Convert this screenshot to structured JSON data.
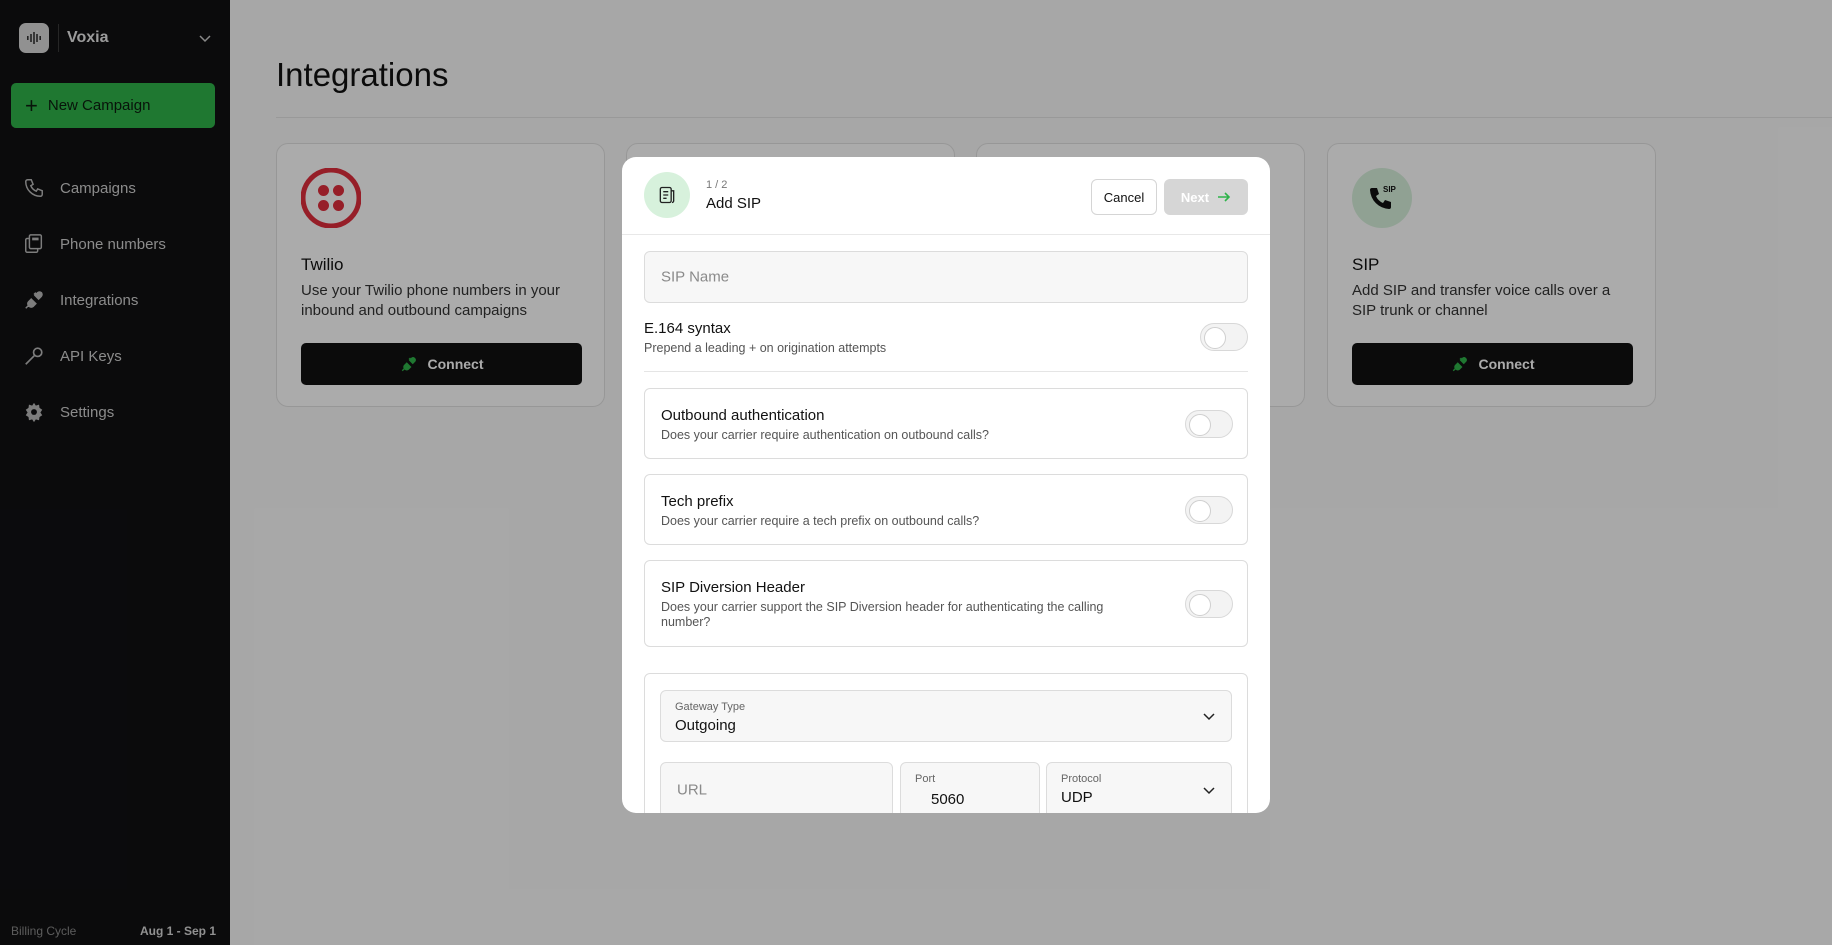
{
  "app": {
    "workspace_name": "Voxia",
    "new_campaign_label": "New Campaign",
    "accent_color": "#2fb34a"
  },
  "sidebar": {
    "items": [
      {
        "label": "Campaigns",
        "icon": "phone-icon"
      },
      {
        "label": "Phone numbers",
        "icon": "phone-numbers-icon"
      },
      {
        "label": "Integrations",
        "icon": "plug-icon"
      },
      {
        "label": "API Keys",
        "icon": "key-icon"
      },
      {
        "label": "Settings",
        "icon": "gear-icon"
      }
    ],
    "billing_label": "Billing Cycle",
    "billing_value": "Aug 1 - Sep 1"
  },
  "main": {
    "title": "Integrations",
    "cards": [
      {
        "title": "Twilio",
        "description": "Use your Twilio phone numbers in your inbound and outbound campaigns",
        "button_label": "Connect"
      },
      {
        "title": "SIP",
        "description": "Add SIP and transfer voice calls over a SIP trunk or channel",
        "button_label": "Connect",
        "logo_text": "SIP"
      }
    ]
  },
  "modal": {
    "step": "1 / 2",
    "title": "Add SIP",
    "cancel_label": "Cancel",
    "next_label": "Next",
    "sip_name_placeholder": "SIP Name",
    "e164": {
      "title": "E.164 syntax",
      "subtitle": "Prepend a leading + on origination attempts",
      "enabled": false
    },
    "outbound_auth": {
      "title": "Outbound authentication",
      "subtitle": "Does your carrier require authentication on outbound calls?",
      "enabled": false
    },
    "tech_prefix": {
      "title": "Tech prefix",
      "subtitle": "Does your carrier require a tech prefix on outbound calls?",
      "enabled": false
    },
    "diversion": {
      "title": "SIP Diversion Header",
      "subtitle": "Does your carrier support the SIP Diversion header for authenticating the calling number?",
      "enabled": false
    },
    "gateway": {
      "type_label": "Gateway Type",
      "type_value": "Outgoing",
      "url_placeholder": "URL",
      "port_label": "Port",
      "port_value": "5060",
      "protocol_label": "Protocol",
      "protocol_value": "UDP"
    }
  }
}
